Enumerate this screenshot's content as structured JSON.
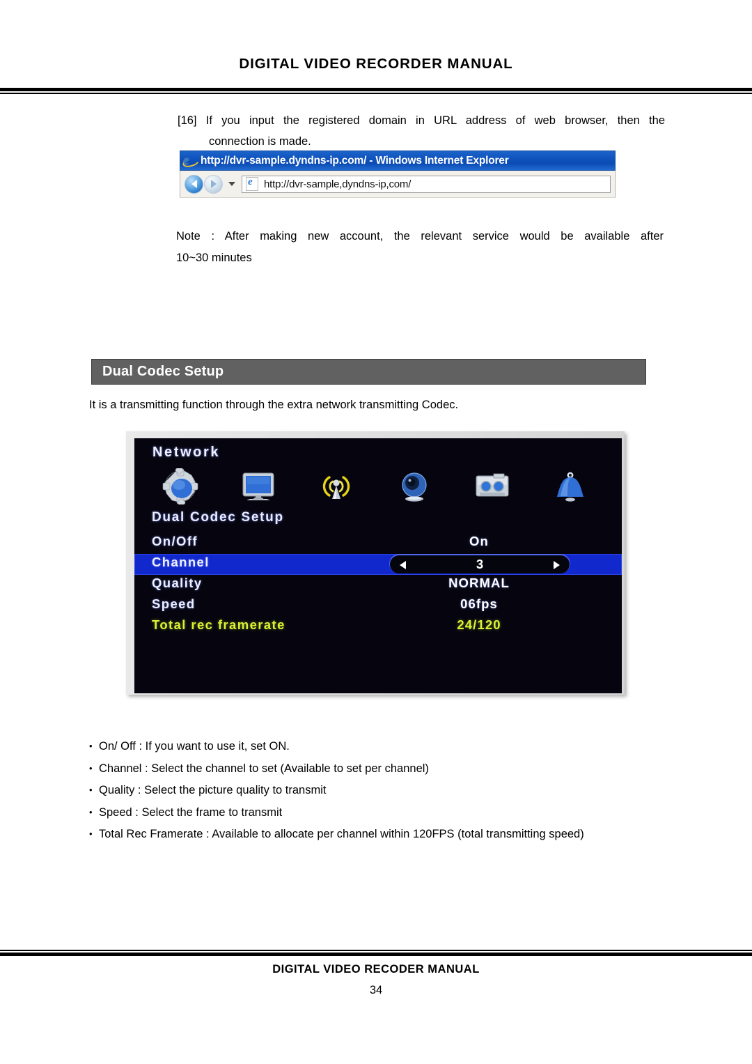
{
  "header": {
    "title": "DIGITAL VIDEO RECORDER MANUAL"
  },
  "step": {
    "line1": "[16] If you input the registered domain in URL address of web browser, then the",
    "line2": "connection is made."
  },
  "browser": {
    "window_title": "http://dvr-sample.dyndns-ip.com/ - Windows Internet Explorer",
    "address_value": "http://dvr-sample,dyndns-ip,com/",
    "back_icon": "back-arrow-icon",
    "forward_icon": "forward-arrow-icon",
    "dropdown_icon": "chevron-down-icon",
    "ie_logo_icon": "internet-explorer-logo-icon",
    "page_icon": "page-favicon-icon"
  },
  "note": {
    "line1": "Note : After making new account, the relevant service would be available after",
    "line2": "10~30 minutes"
  },
  "section": {
    "heading": "Dual Codec Setup",
    "description": "It is a transmitting function through the extra network transmitting Codec.",
    "heading_bg": "#616161"
  },
  "dvr": {
    "title": "Network",
    "menu_title": "Dual Codec Setup",
    "icons": [
      {
        "name": "gear-setup-icon",
        "label": "gear"
      },
      {
        "name": "monitor-display-icon",
        "label": "monitor"
      },
      {
        "name": "antenna-network-icon",
        "label": "antenna"
      },
      {
        "name": "camera-icon",
        "label": "camera"
      },
      {
        "name": "storage-tape-icon",
        "label": "storage"
      },
      {
        "name": "bell-alarm-icon",
        "label": "bell"
      }
    ],
    "rows": [
      {
        "label": "On/Off",
        "value": "On",
        "selected": false,
        "color": "white"
      },
      {
        "label": "Channel",
        "value": "3",
        "selected": true,
        "color": "white"
      },
      {
        "label": "Quality",
        "value": "NORMAL",
        "selected": false,
        "color": "white"
      },
      {
        "label": "Speed",
        "value": "06fps",
        "selected": false,
        "color": "white"
      },
      {
        "label": "Total rec framerate",
        "value": "24/120",
        "selected": false,
        "color": "yellow"
      }
    ],
    "highlight_color": "#1128cc",
    "yellow_color": "#ddf033",
    "screen_bg": "#06050f"
  },
  "bullets": [
    "On/ Off : If you want to use it, set ON.",
    "Channel : Select the channel to set (Available to set per channel)",
    "Quality : Select the picture quality to transmit",
    "Speed : Select the frame to transmit",
    "Total Rec Framerate : Available to allocate per channel within 120FPS (total transmitting speed)"
  ],
  "footer": {
    "text": "DIGITAL VIDEO RECODER MANUAL",
    "page_number": "34"
  }
}
